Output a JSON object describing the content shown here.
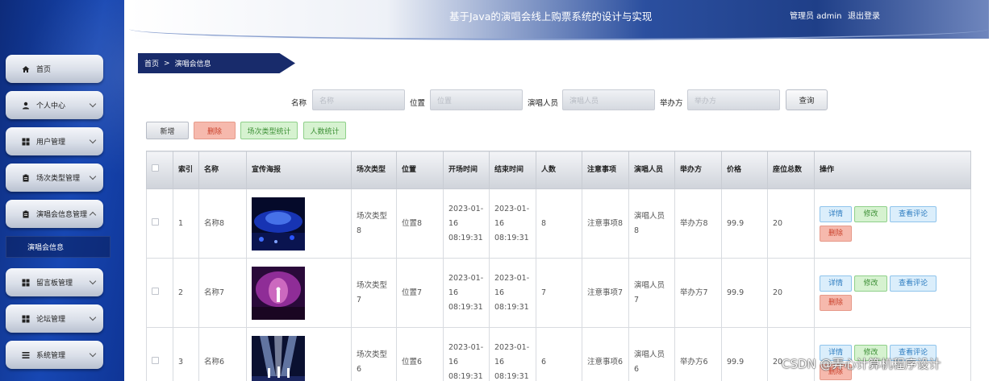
{
  "header": {
    "title": "基于Java的演唱会线上购票系统的设计与实现",
    "admin_label": "管理员 admin",
    "logout_label": "退出登录"
  },
  "sidebar": {
    "items": [
      {
        "label": "首页",
        "icon": "home-icon"
      },
      {
        "label": "个人中心",
        "icon": "user-icon"
      },
      {
        "label": "用户管理",
        "icon": "grid-icon"
      },
      {
        "label": "场次类型管理",
        "icon": "clipboard-icon"
      },
      {
        "label": "演唱会信息管理",
        "icon": "clipboard-icon"
      },
      {
        "label": "留言板管理",
        "icon": "grid-icon"
      },
      {
        "label": "论坛管理",
        "icon": "grid-icon"
      },
      {
        "label": "系统管理",
        "icon": "list-icon"
      }
    ],
    "sub_item": "演唱会信息"
  },
  "breadcrumb": {
    "home": "首页",
    "sep": ">",
    "current": "演唱会信息"
  },
  "search": {
    "fields": [
      {
        "label": "名称",
        "placeholder": "名称"
      },
      {
        "label": "位置",
        "placeholder": "位置"
      },
      {
        "label": "演唱人员",
        "placeholder": "演唱人员"
      },
      {
        "label": "举办方",
        "placeholder": "举办方"
      }
    ],
    "query_label": "查询"
  },
  "actions": {
    "add": "新增",
    "delete": "删除",
    "stat_type": "场次类型统计",
    "stat_people": "人数统计"
  },
  "table": {
    "headers": [
      "索引",
      "名称",
      "宣传海报",
      "场次类型",
      "位置",
      "开场时间",
      "结束时间",
      "人数",
      "注意事项",
      "演唱人员",
      "举办方",
      "价格",
      "座位总数",
      "操作"
    ],
    "row_buttons": {
      "detail": "详情",
      "edit": "修改",
      "comment": "查看评论",
      "delete": "删除"
    },
    "rows": [
      {
        "index": "1",
        "name": "名称8",
        "poster": "blue-concert",
        "type": "场次类型8",
        "location": "位置8",
        "start": "2023-01-16 08:19:31",
        "end": "2023-01-16 08:19:31",
        "people": "8",
        "notes": "注意事项8",
        "singer": "演唱人员8",
        "organizer": "举办方8",
        "price": "99.9",
        "seats": "20"
      },
      {
        "index": "2",
        "name": "名称7",
        "poster": "purple-stage",
        "type": "场次类型7",
        "location": "位置7",
        "start": "2023-01-16 08:19:31",
        "end": "2023-01-16 08:19:31",
        "people": "7",
        "notes": "注意事项7",
        "singer": "演唱人员7",
        "organizer": "举办方7",
        "price": "99.9",
        "seats": "20"
      },
      {
        "index": "3",
        "name": "名称6",
        "poster": "spotlight-stage",
        "type": "场次类型6",
        "location": "位置6",
        "start": "2023-01-16 08:19:31",
        "end": "2023-01-16 08:19:31",
        "people": "6",
        "notes": "注意事项6",
        "singer": "演唱人员6",
        "organizer": "举办方6",
        "price": "99.9",
        "seats": "20"
      }
    ]
  },
  "watermark": "CSDN @弄心计算机程序设计"
}
